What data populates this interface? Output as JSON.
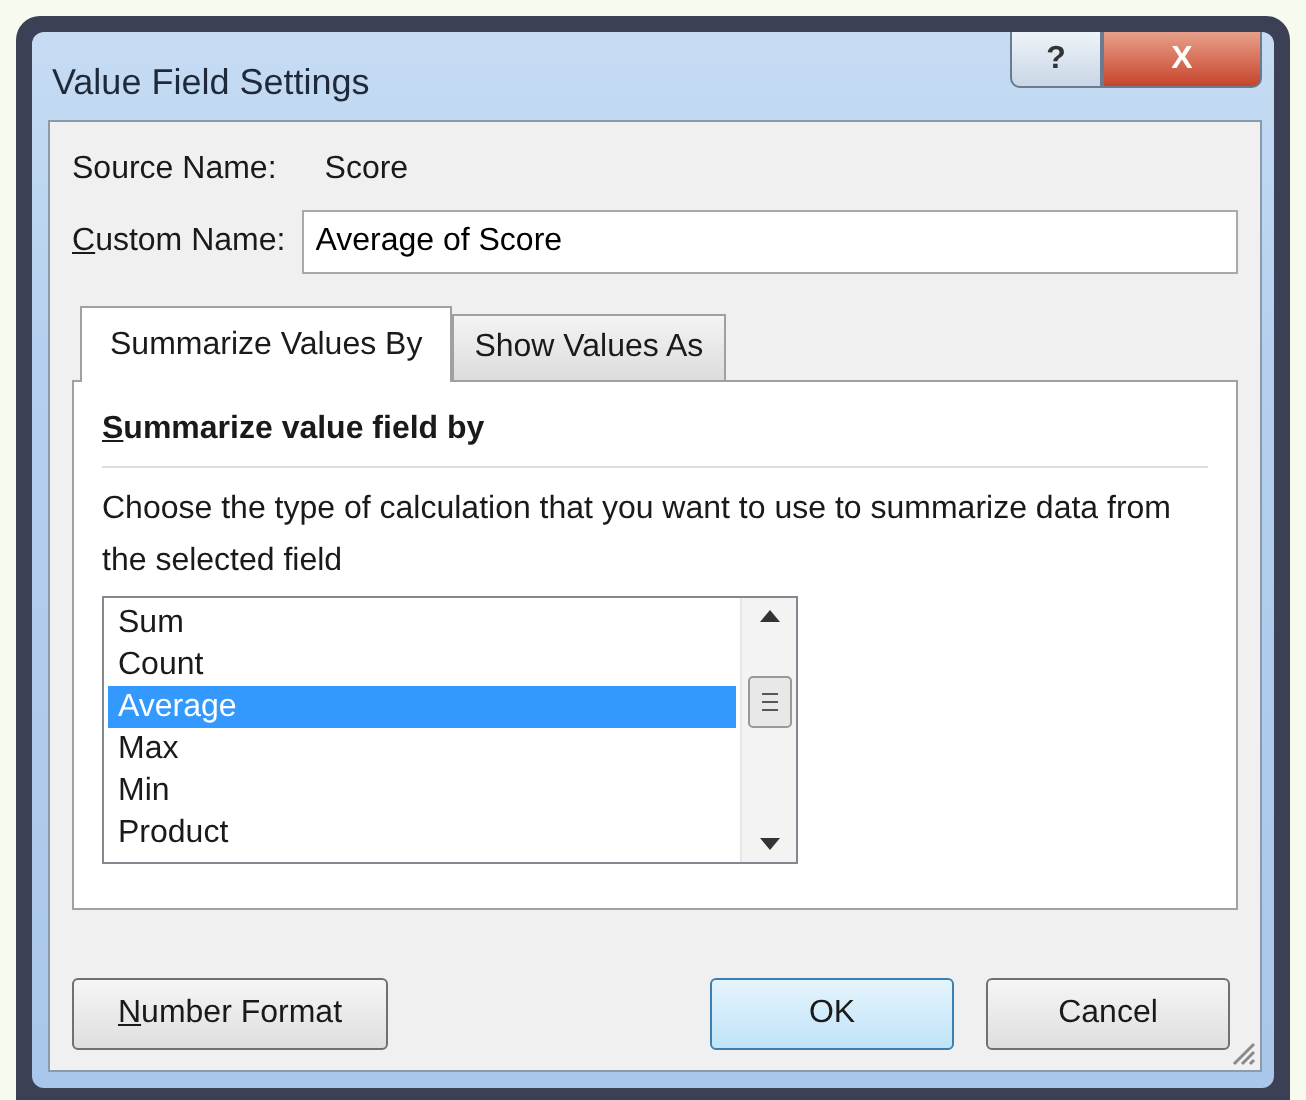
{
  "window": {
    "title": "Value Field Settings",
    "caption_buttons": [
      {
        "kind": "help",
        "label": "?"
      },
      {
        "kind": "close",
        "label": "X"
      }
    ]
  },
  "source_name": {
    "label": "Source Name:",
    "value": "Score"
  },
  "custom_name": {
    "label": "Custom Name:",
    "mnemonic_underlined": true,
    "value": "Average of Score"
  },
  "tabs": [
    {
      "label": "Summarize Values By",
      "selected": true
    },
    {
      "label": "Show Values As",
      "selected": false
    }
  ],
  "section": {
    "heading": "Summarize value field by",
    "mnemonic_underlined": true,
    "description": "Choose the type of calculation that you want to use to summarize data from the selected field"
  },
  "list_items": [
    {
      "label": "Sum",
      "selected": false
    },
    {
      "label": "Count",
      "selected": false
    },
    {
      "label": "Average",
      "selected": true
    },
    {
      "label": "Max",
      "selected": false
    },
    {
      "label": "Min",
      "selected": false
    },
    {
      "label": "Product",
      "selected": false
    }
  ],
  "buttons": [
    {
      "label": "Number Format",
      "kind": "secondary",
      "mnemonic_underlined": true
    },
    {
      "label": "OK",
      "kind": "default",
      "mnemonic_underlined": false
    },
    {
      "label": "Cancel",
      "kind": "secondary",
      "mnemonic_underlined": false
    }
  ]
}
